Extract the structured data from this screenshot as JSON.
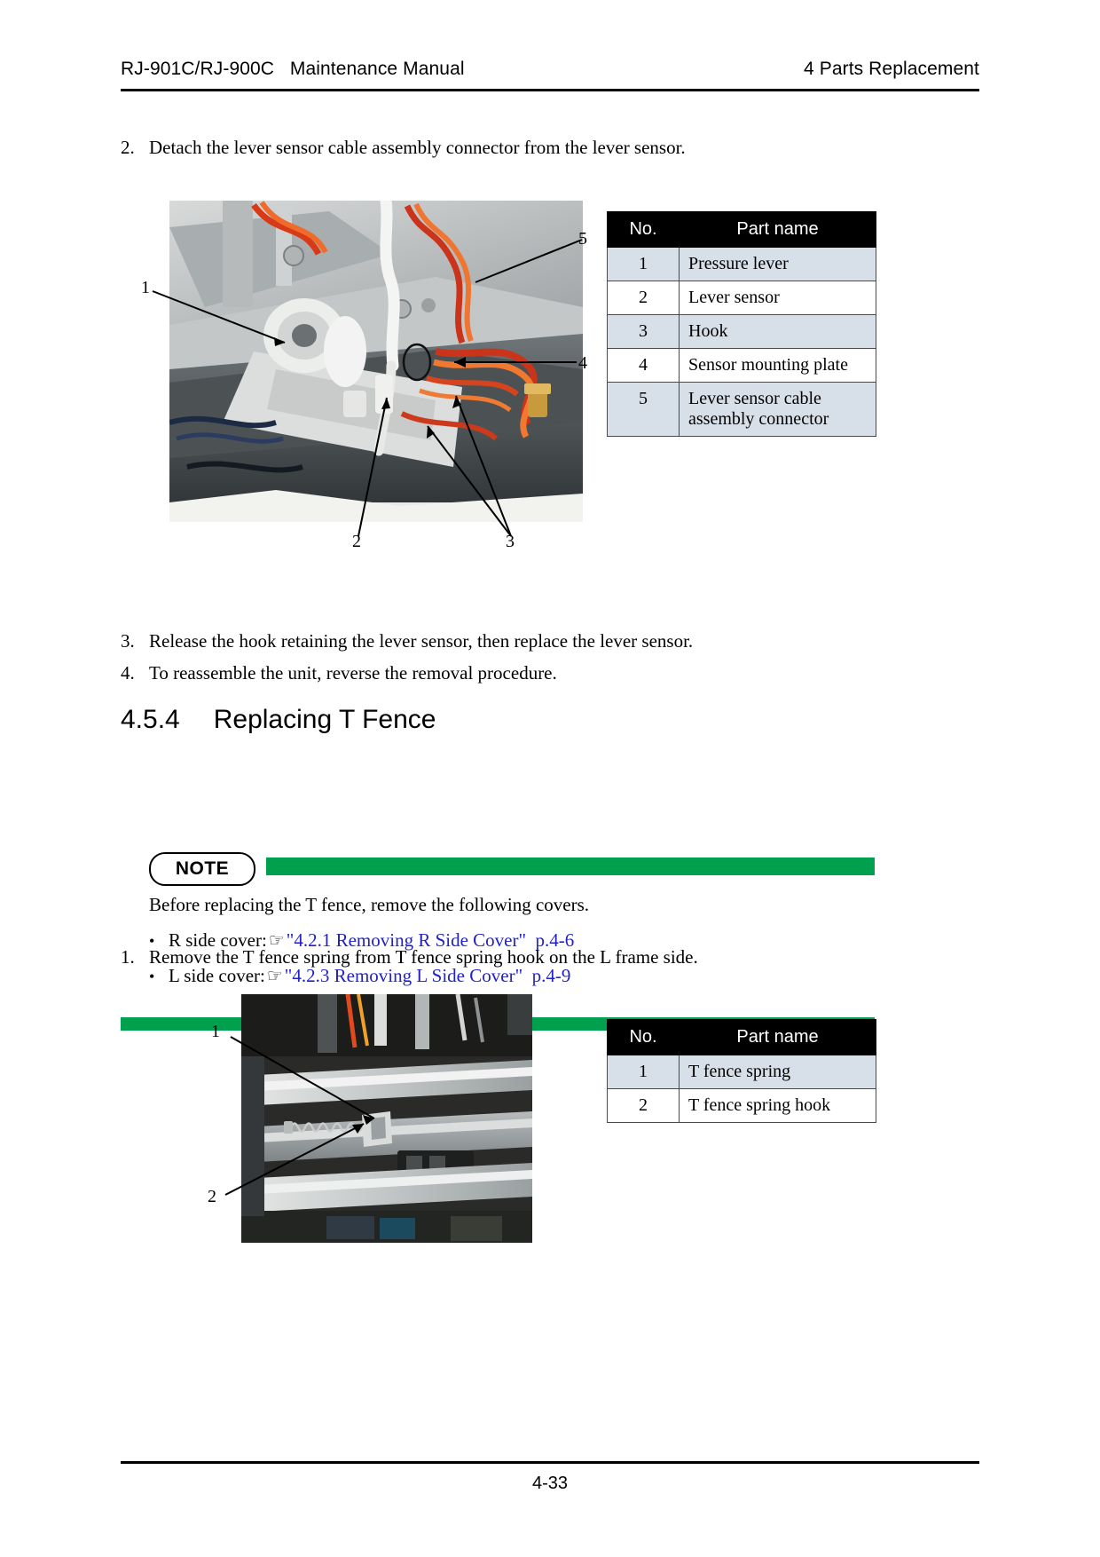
{
  "header": {
    "left": "RJ-901C/RJ-900C   Maintenance Manual",
    "right": "4 Parts Replacement"
  },
  "footer": {
    "page_number": "4-33"
  },
  "steps": {
    "step2": {
      "number": "2.",
      "text": "Detach the lever sensor cable assembly connector from the lever sensor."
    },
    "step3": {
      "number": "3.",
      "text": "Release the hook retaining the lever sensor, then replace the lever sensor."
    },
    "step4": {
      "number": "4.",
      "text": "To reassemble the unit, reverse the removal procedure."
    },
    "step1b": {
      "number": "1.",
      "text": "Remove the T fence spring from T fence spring hook on the L frame side."
    }
  },
  "section": {
    "number": "4.5.4",
    "title": "Replacing T Fence"
  },
  "note": {
    "badge": "NOTE",
    "intro": "Before replacing the T fence, remove the following covers.",
    "bullets": [
      {
        "label": "R side cover:",
        "icon": "pointing-hand-icon",
        "link": "\"4.2.1 Removing R Side Cover\"  p.4-6"
      },
      {
        "label": "L side cover:",
        "icon": "pointing-hand-icon",
        "link": "\"4.2.3 Removing L Side Cover\"  p.4-9"
      }
    ]
  },
  "figure1": {
    "callouts": [
      "1",
      "2",
      "3",
      "4",
      "5"
    ],
    "table": {
      "columns": [
        "No.",
        "Part name"
      ],
      "rows": [
        {
          "no": "1",
          "name": "Pressure lever"
        },
        {
          "no": "2",
          "name": "Lever sensor"
        },
        {
          "no": "3",
          "name": "Hook"
        },
        {
          "no": "4",
          "name": "Sensor mounting plate"
        },
        {
          "no": "5",
          "name": "Lever sensor cable assembly connector"
        }
      ]
    }
  },
  "figure2": {
    "callouts": [
      "1",
      "2"
    ],
    "table": {
      "columns": [
        "No.",
        "Part name"
      ],
      "rows": [
        {
          "no": "1",
          "name": "T fence spring"
        },
        {
          "no": "2",
          "name": "T fence spring hook"
        }
      ]
    }
  },
  "colors": {
    "note_green": "#00a04e",
    "link_blue": "#2222c4",
    "table_header_bg": "#000000",
    "table_alt_row_bg": "#d7dfe8"
  }
}
